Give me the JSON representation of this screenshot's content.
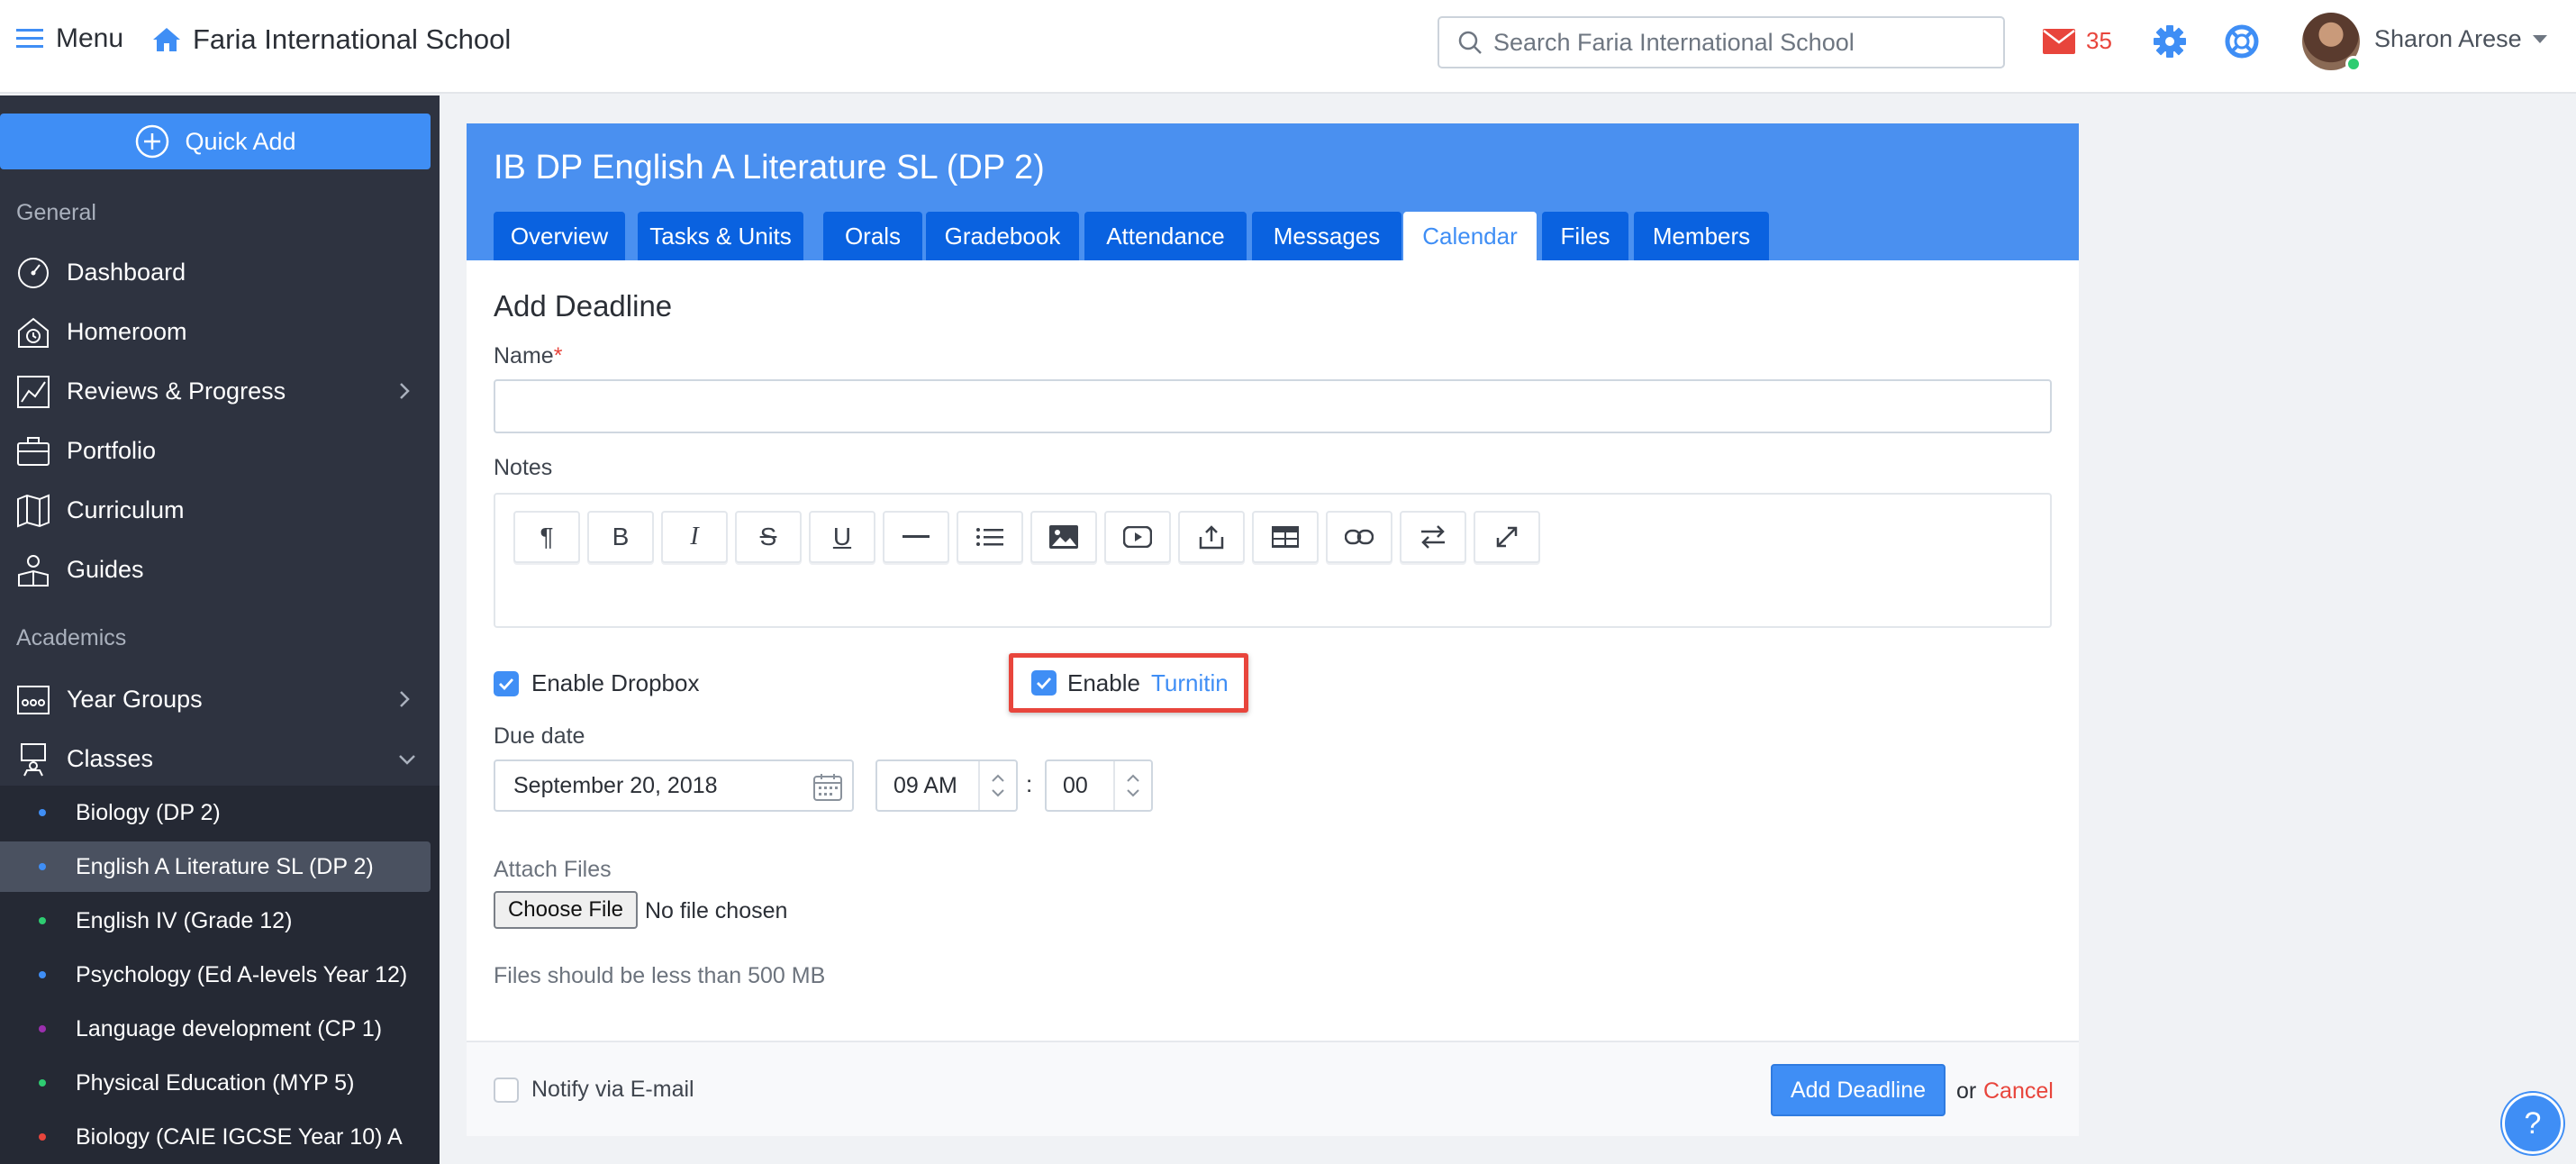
{
  "header": {
    "menu_label": "Menu",
    "school_name": "Faria International School",
    "search_placeholder": "Search Faria International School",
    "mail_count": "35",
    "user_name": "Sharon Arese"
  },
  "sidebar": {
    "quick_add": "Quick Add",
    "general_label": "General",
    "general_items": [
      {
        "label": "Dashboard"
      },
      {
        "label": "Homeroom"
      },
      {
        "label": "Reviews & Progress"
      },
      {
        "label": "Portfolio"
      },
      {
        "label": "Curriculum"
      },
      {
        "label": "Guides"
      }
    ],
    "academics_label": "Academics",
    "academics_items": [
      {
        "label": "Year Groups"
      },
      {
        "label": "Classes"
      }
    ],
    "classes": [
      {
        "label": "Biology (DP 2)",
        "color": "#3f8ef5"
      },
      {
        "label": "English A Literature SL (DP 2)",
        "color": "#3f8ef5"
      },
      {
        "label": "English IV (Grade 12)",
        "color": "#2ecc71"
      },
      {
        "label": "Psychology (Ed A-levels Year 12)",
        "color": "#3f8ef5"
      },
      {
        "label": "Language development (CP 1)",
        "color": "#9b2fae"
      },
      {
        "label": "Physical Education (MYP 5)",
        "color": "#2ecc71"
      },
      {
        "label": "Biology (CAIE IGCSE Year 10) A",
        "color": "#e8453c"
      }
    ]
  },
  "course": {
    "title": "IB DP English A Literature SL (DP 2)",
    "tabs": [
      {
        "label": "Overview"
      },
      {
        "label": "Tasks & Units"
      },
      {
        "label": "Orals"
      },
      {
        "label": "Gradebook"
      },
      {
        "label": "Attendance"
      },
      {
        "label": "Messages"
      },
      {
        "label": "Calendar"
      },
      {
        "label": "Files"
      },
      {
        "label": "Members"
      }
    ],
    "active_tab": "Calendar"
  },
  "form": {
    "title": "Add Deadline",
    "name_label": "Name",
    "required_mark": "*",
    "name_value": "",
    "notes_label": "Notes",
    "toolbar_icons": [
      "paragraph-icon",
      "bold-icon",
      "italic-icon",
      "strikethrough-icon",
      "underline-icon",
      "horizontal-rule-icon",
      "list-icon",
      "image-icon",
      "video-icon",
      "upload-icon",
      "table-icon",
      "link-icon",
      "swap-icon",
      "fullscreen-icon"
    ],
    "enable_dropbox": "Enable Dropbox",
    "enable_prefix": "Enable",
    "turnitin_link": "Turnitin",
    "due_label": "Due date",
    "due_date": "September 20, 2018",
    "hour": "09 AM",
    "time_sep": ":",
    "minute": "00",
    "attach_label": "Attach Files",
    "choose_file": "Choose File",
    "no_file": "No file chosen",
    "file_note": "Files should be less than 500 MB",
    "notify_label": "Notify via E-mail",
    "submit": "Add Deadline",
    "or": "or",
    "cancel": "Cancel"
  },
  "help": "?",
  "colors": {
    "accent": "#3f8ef5",
    "danger": "#e8453c",
    "sidebar": "#2e3340"
  }
}
